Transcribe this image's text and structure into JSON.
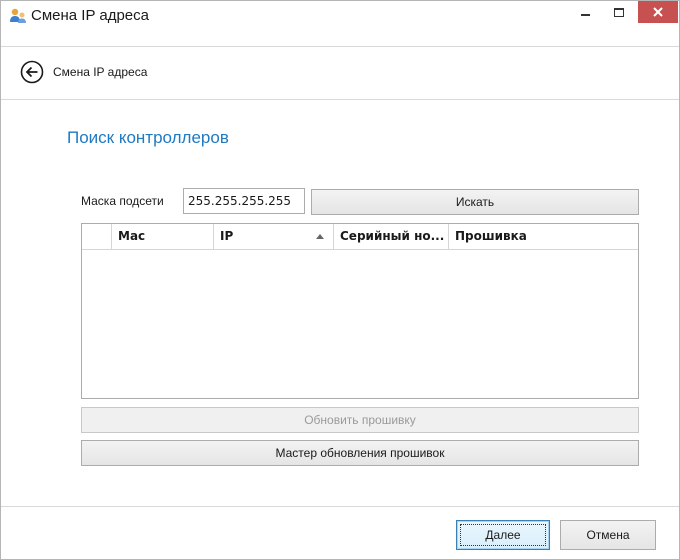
{
  "window": {
    "title": "Смена IP адреса",
    "icon": "users-icon",
    "controls": {
      "minimize": "minimize-icon",
      "maximize": "maximize-icon",
      "close": "close-icon"
    },
    "close_color": "#c75050"
  },
  "nav": {
    "back_icon": "back-arrow-icon",
    "title": "Смена IP адреса"
  },
  "section": {
    "heading": "Поиск контроллеров",
    "heading_color": "#1e7ac3"
  },
  "search": {
    "mask_label": "Маска подсети",
    "mask_value": "255.255.255.255",
    "search_button": "Искать"
  },
  "table": {
    "columns": [
      "",
      "Mac",
      "IP",
      "Серийный но...",
      "Прошивка"
    ],
    "sorted_column": "IP",
    "sort_direction": "ascending",
    "rows": []
  },
  "actions": {
    "update_firmware": "Обновить прошивку",
    "update_firmware_enabled": false,
    "firmware_wizard": "Мастер обновления прошивок"
  },
  "footer": {
    "next": "Далее",
    "cancel": "Отмена"
  }
}
